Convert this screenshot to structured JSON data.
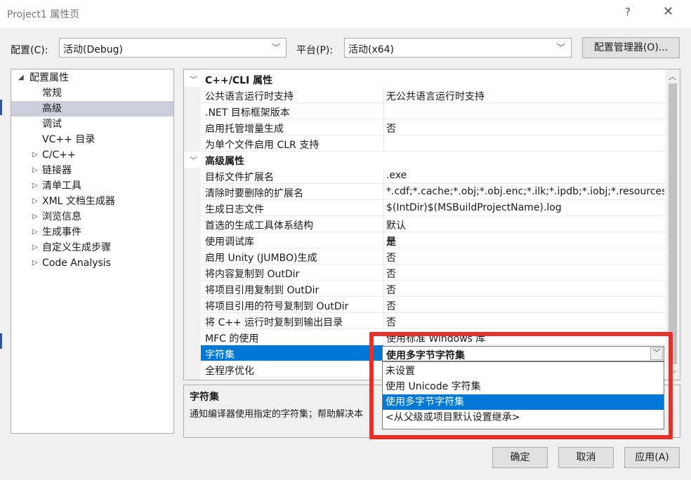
{
  "window": {
    "title": "Project1 属性页",
    "help_glyph": "?",
    "close_glyph": "✕"
  },
  "config": {
    "config_label": "配置(C):",
    "config_value": "活动(Debug)",
    "platform_label": "平台(P):",
    "platform_value": "活动(x64)",
    "manager_button": "配置管理器(O)..."
  },
  "tree": {
    "items": [
      {
        "label": "配置属性",
        "expanded": true
      },
      {
        "label": "常规"
      },
      {
        "label": "高级",
        "selected": true
      },
      {
        "label": "调试"
      },
      {
        "label": "VC++ 目录"
      },
      {
        "label": "C/C++"
      },
      {
        "label": "链接器"
      },
      {
        "label": "清单工具"
      },
      {
        "label": "XML 文档生成器"
      },
      {
        "label": "浏览信息"
      },
      {
        "label": "生成事件"
      },
      {
        "label": "自定义生成步骤"
      },
      {
        "label": "Code Analysis"
      }
    ]
  },
  "grid": {
    "cat1": "C++/CLI 属性",
    "cat2": "高级属性",
    "rows": [
      {
        "name": "公共语言运行时支持",
        "value": "无公共语言运行时支持"
      },
      {
        "name": ".NET 目标框架版本",
        "value": ""
      },
      {
        "name": "启用托管增量生成",
        "value": "否"
      },
      {
        "name": "为单个文件启用 CLR 支持",
        "value": ""
      },
      {
        "name": "目标文件扩展名",
        "value": ".exe"
      },
      {
        "name": "清除时要删除的扩展名",
        "value": "*.cdf;*.cache;*.obj;*.obj.enc;*.ilk;*.ipdb;*.iobj;*.resources"
      },
      {
        "name": "生成日志文件",
        "value": "$(IntDir)$(MSBuildProjectName).log"
      },
      {
        "name": "首选的生成工具体系结构",
        "value": "默认"
      },
      {
        "name": "使用调试库",
        "value": "是"
      },
      {
        "name": "启用 Unity (JUMBO)生成",
        "value": "否"
      },
      {
        "name": "将内容复制到 OutDir",
        "value": "否"
      },
      {
        "name": "将项目引用复制到 OutDir",
        "value": "否"
      },
      {
        "name": "将项目引用的符号复制到 OutDir",
        "value": "否"
      },
      {
        "name": "将 C++ 运行时复制到输出目录",
        "value": "否"
      },
      {
        "name": "MFC 的使用",
        "value": "使用标准 Windows 库"
      },
      {
        "name": "字符集",
        "value": "使用多字节字符集"
      },
      {
        "name": "全程序优化",
        "value": ""
      }
    ]
  },
  "dropdown": {
    "options": [
      "未设置",
      "使用 Unicode 字符集",
      "使用多字节字符集",
      "<从父级或项目默认设置继承>"
    ],
    "selected_index": 2
  },
  "description": {
    "title": "字符集",
    "text": "通知编译器使用指定的字符集；帮助解决本"
  },
  "buttons": {
    "ok": "确定",
    "cancel": "取消",
    "apply": "应用(A)"
  },
  "colors": {
    "selection": "#0078d7",
    "highlight_box": "#e8302b"
  }
}
